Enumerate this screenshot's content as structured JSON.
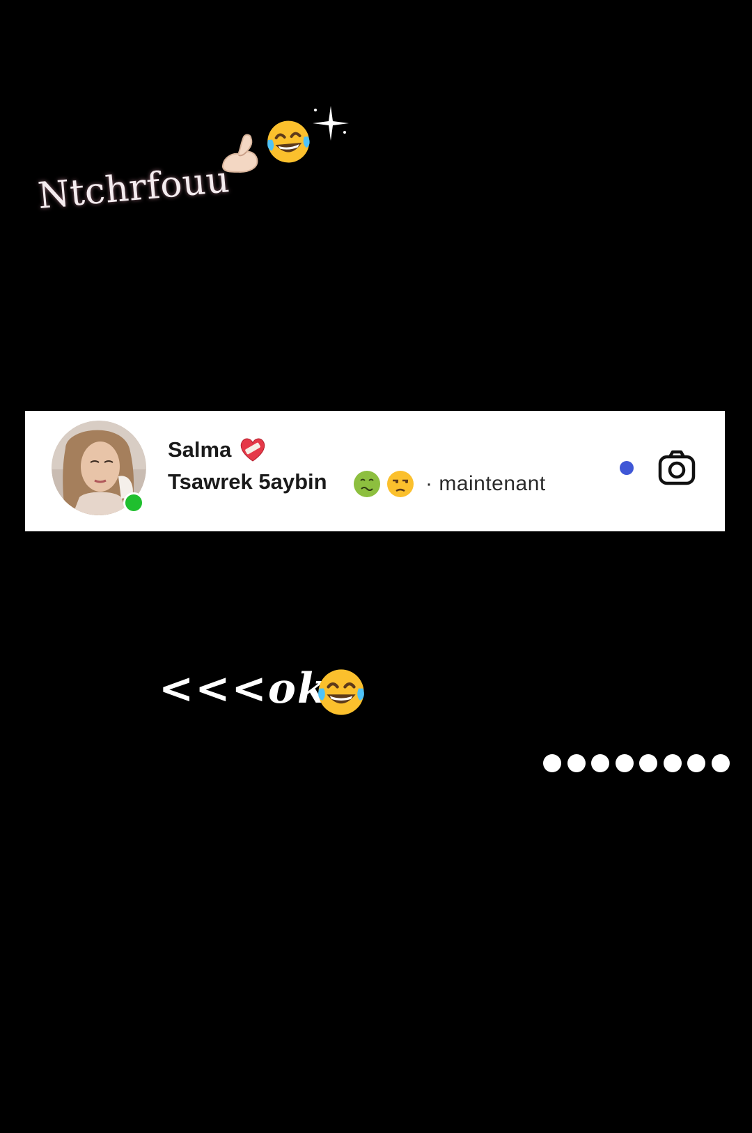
{
  "top_caption": {
    "text": "Ntchrfouu",
    "icons": [
      "pinching-hand-icon",
      "face-with-tears-of-joy-icon",
      "sparkles-icon"
    ]
  },
  "notification": {
    "sender": "Salma",
    "sender_icon": "mending-heart-icon",
    "message": "Tsawrek 5aybin",
    "message_icons": [
      "nauseated-face-icon",
      "unamused-face-icon"
    ],
    "time": "· maintenant",
    "online_status_color": "#1fbf2e",
    "unread_color": "#3f57d6",
    "action_icon": "camera-icon"
  },
  "bottom_caption": {
    "text": "<<<ok",
    "icon": "face-with-tears-of-joy-icon"
  },
  "dots": {
    "count": 8
  },
  "colors": {
    "background": "#000000",
    "card": "#ffffff"
  }
}
